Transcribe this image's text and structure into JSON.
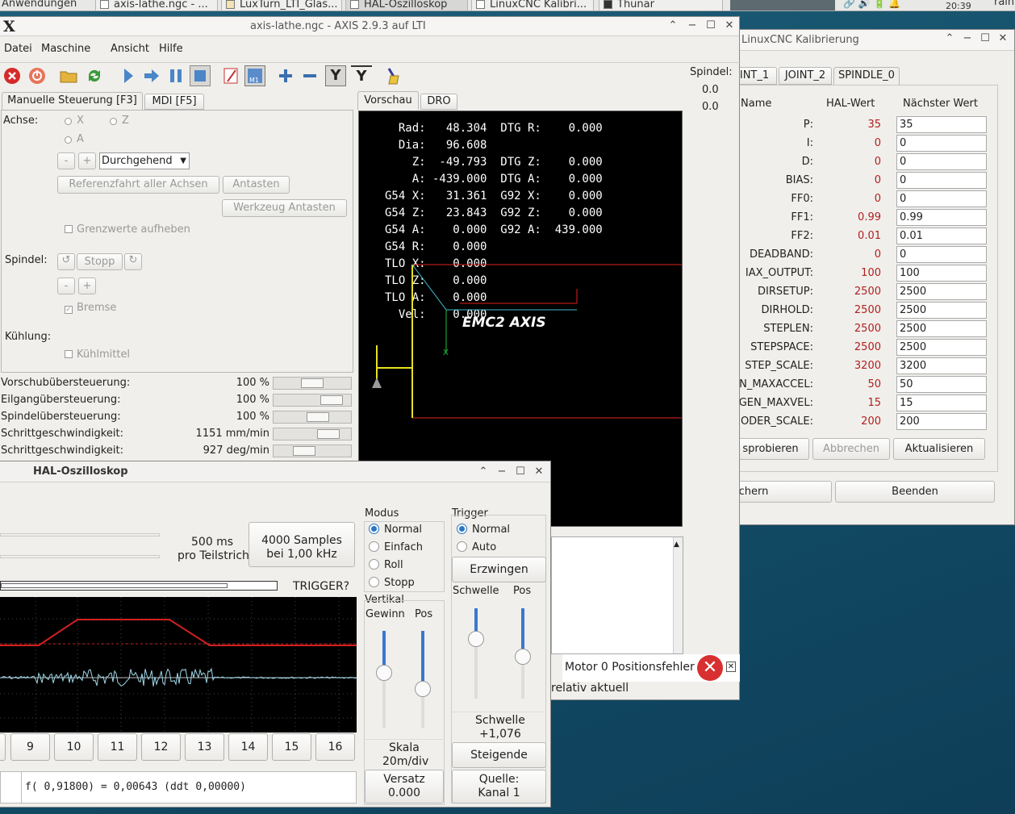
{
  "taskbar": {
    "items": [
      "Anwendungen",
      "axis-lathe.ngc - ...",
      "LuxTurn_LTI_Glas...",
      "HAL-Oszilloskop",
      "LinuxCNC Kalibri...",
      "Thunar"
    ],
    "time": "20:39",
    "user": "rain"
  },
  "axis": {
    "title": "axis-lathe.ngc - AXIS 2.9.3 auf LTI",
    "menu": [
      "Datei",
      "Maschine",
      "Ansicht",
      "Hilfe"
    ],
    "tabs_left": [
      "Manuelle Steuerung [F3]",
      "MDI [F5]"
    ],
    "tabs_right": [
      "Vorschau",
      "DRO"
    ],
    "achse_label": "Achse:",
    "axes": [
      "X",
      "Z",
      "A"
    ],
    "minus": "-",
    "plus": "+",
    "jog_mode": "Durchgehend",
    "btn_home": "Referenzfahrt aller Achsen",
    "btn_touch": "Antasten",
    "btn_tool_touch": "Werkzeug Antasten",
    "override_limits": "Grenzwerte aufheben",
    "spindle_label": "Spindel:",
    "spindle_stop": "Stopp",
    "brake": "Bremse",
    "cooling_label": "Kühlung:",
    "coolant": "Kühlmittel",
    "overrides": [
      {
        "label": "Vorschubübersteuerung:",
        "value": "100 %",
        "pct": 0.5
      },
      {
        "label": "Eilgangübersteuerung:",
        "value": "100 %",
        "pct": 0.85
      },
      {
        "label": "Spindelübersteuerung:",
        "value": "100 %",
        "pct": 0.6
      },
      {
        "label": "Schrittgeschwindigkeit:",
        "value": "1151 mm/min",
        "pct": 0.8
      },
      {
        "label": "Schrittgeschwindigkeit:",
        "value": "927 deg/min",
        "pct": 0.35
      }
    ],
    "spindle_side": {
      "label": "Spindel:",
      "v1": "0.0",
      "v2": "0.0"
    },
    "dro_lines": [
      "  Rad:   48.304  DTG R:    0.000",
      "  Dia:   96.608",
      "    Z:  -49.793  DTG Z:    0.000",
      "    A: -439.000  DTG A:    0.000",
      "G54 X:   31.361  G92 X:    0.000",
      "G54 Z:   23.843  G92 Z:    0.000",
      "G54 A:    0.000  G92 A:  439.000",
      "G54 R:    0.000",
      "TLO X:    0.000",
      "TLO Z:    0.000",
      "TLO A:    0.000",
      "  Vel:    0.000"
    ],
    "preview_logo": "EMC2 AXIS",
    "preview_x_label": "X",
    "error_msg": "Motor 0 Positionsfehler",
    "status": "relativ aktuell"
  },
  "calib": {
    "title": "LinuxCNC Kalibrierung",
    "tabs": [
      "INT_1",
      "JOINT_2",
      "SPINDLE_0"
    ],
    "col_name": "Name",
    "col_hal": "HAL-Wert",
    "col_next": "Nächster Wert",
    "rows": [
      {
        "name": "P:",
        "hal": "35",
        "next": "35"
      },
      {
        "name": "I:",
        "hal": "0",
        "next": "0"
      },
      {
        "name": "D:",
        "hal": "0",
        "next": "0"
      },
      {
        "name": "BIAS:",
        "hal": "0",
        "next": "0"
      },
      {
        "name": "FF0:",
        "hal": "0",
        "next": "0"
      },
      {
        "name": "FF1:",
        "hal": "0.99",
        "next": "0.99"
      },
      {
        "name": "FF2:",
        "hal": "0.01",
        "next": "0.01"
      },
      {
        "name": "DEADBAND:",
        "hal": "0",
        "next": "0"
      },
      {
        "name": "IAX_OUTPUT:",
        "hal": "100",
        "next": "100"
      },
      {
        "name": "DIRSETUP:",
        "hal": "2500",
        "next": "2500"
      },
      {
        "name": "DIRHOLD:",
        "hal": "2500",
        "next": "2500"
      },
      {
        "name": "STEPLEN:",
        "hal": "2500",
        "next": "2500"
      },
      {
        "name": "STEPSPACE:",
        "hal": "2500",
        "next": "2500"
      },
      {
        "name": "STEP_SCALE:",
        "hal": "3200",
        "next": "3200"
      },
      {
        "name": "N_MAXACCEL:",
        "hal": "50",
        "next": "50"
      },
      {
        "name": "GEN_MAXVEL:",
        "hal": "15",
        "next": "15"
      },
      {
        "name": "ODER_SCALE:",
        "hal": "200",
        "next": "200"
      }
    ],
    "btn_try": "sprobieren",
    "btn_cancel": "Abbrechen",
    "btn_refresh": "Aktualisieren",
    "btn_save": "ichern",
    "btn_quit": "Beenden"
  },
  "scope": {
    "title": "HAL-Oszilloskop",
    "time_div": "500 ms",
    "time_div2": "pro Teilstrich",
    "samples": "4000 Samples",
    "samples2": "bei 1,00 kHz",
    "trigger_status": "TRIGGER?",
    "modus_label": "Modus",
    "modus": [
      "Normal",
      "Einfach",
      "Roll",
      "Stopp"
    ],
    "trigger_label": "Trigger",
    "trigger_modes": [
      "Normal",
      "Auto"
    ],
    "force": "Erzwingen",
    "schwelle": "Schwelle",
    "pos": "Pos",
    "vertikal": "Vertikal",
    "gewinn": "Gewinn",
    "schwelle_val_label": "Schwelle",
    "schwelle_val": "+1,076",
    "edge": "Steigende",
    "skala": "Skala",
    "skala_val": "20m/div",
    "versatz": "Versatz",
    "versatz_val": "0.000",
    "quelle": "Quelle:",
    "quelle_val": "Kanal  1",
    "channels": [
      "9",
      "10",
      "11",
      "12",
      "13",
      "14",
      "15",
      "16"
    ],
    "readout": "f( 0,91800) =  0,00643 (ddt  0,00000)"
  }
}
